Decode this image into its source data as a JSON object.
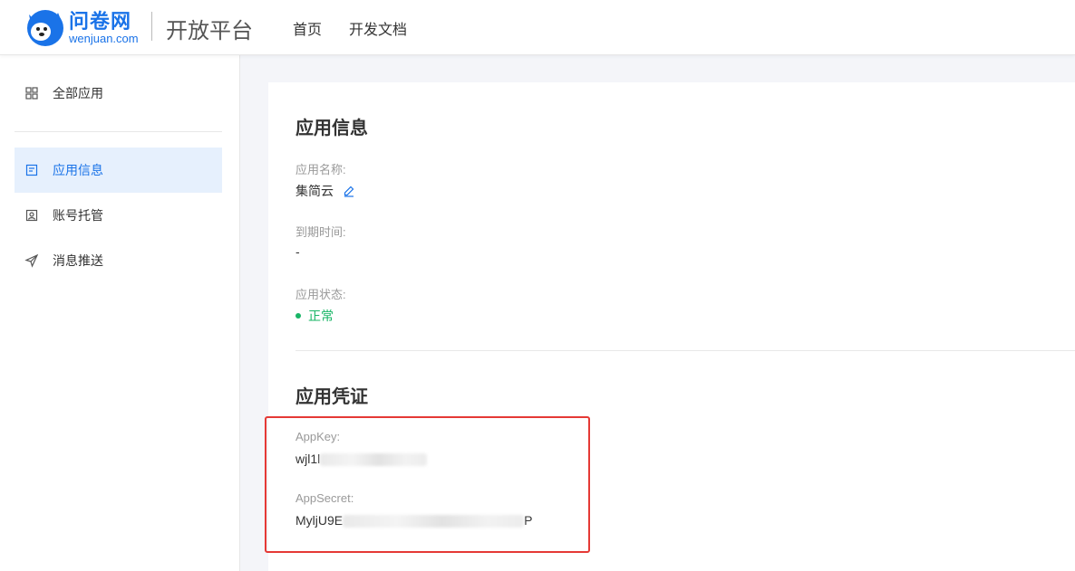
{
  "header": {
    "brand_cn": "问卷网",
    "brand_en": "wenjuan.com",
    "platform_title": "开放平台",
    "nav": [
      {
        "label": "首页"
      },
      {
        "label": "开发文档"
      }
    ]
  },
  "sidebar": {
    "items": [
      {
        "label": "全部应用",
        "icon": "grid-icon"
      },
      {
        "label": "应用信息",
        "icon": "document-icon",
        "active": true
      },
      {
        "label": "账号托管",
        "icon": "portrait-icon"
      },
      {
        "label": "消息推送",
        "icon": "paper-plane-icon"
      }
    ]
  },
  "app_info": {
    "title": "应用信息",
    "name_label": "应用名称:",
    "name_value": "集简云",
    "expire_label": "到期时间:",
    "expire_value": "-",
    "status_label": "应用状态:",
    "status_value": "正常"
  },
  "credentials": {
    "title": "应用凭证",
    "appkey_label": "AppKey:",
    "appkey_prefix": "wjl1l",
    "appsecret_label": "AppSecret:",
    "appsecret_prefix": "MyljU9E",
    "appsecret_suffix": "P"
  },
  "colors": {
    "accent": "#1a73e8",
    "status_ok": "#18b566",
    "highlight": "#e53935"
  }
}
